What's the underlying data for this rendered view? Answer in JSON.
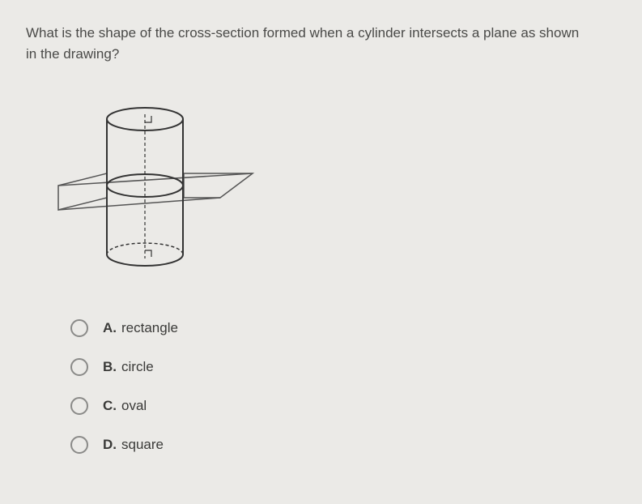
{
  "question": "What is the shape of the cross-section formed when a cylinder intersects a plane as shown in the drawing?",
  "options": [
    {
      "letter": "A.",
      "text": "rectangle"
    },
    {
      "letter": "B.",
      "text": "circle"
    },
    {
      "letter": "C.",
      "text": "oval"
    },
    {
      "letter": "D.",
      "text": "square"
    }
  ]
}
